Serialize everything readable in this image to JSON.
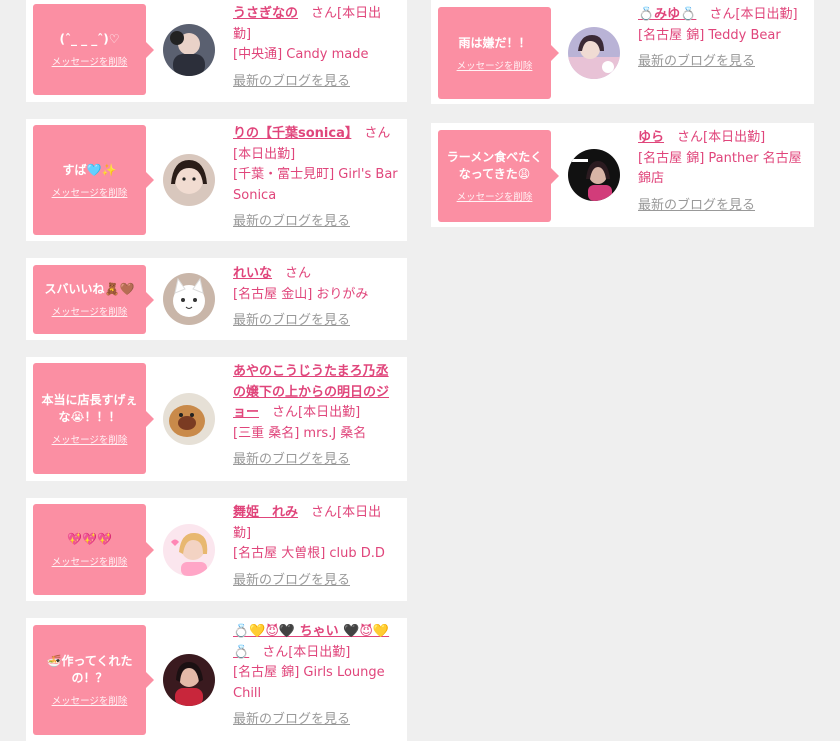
{
  "delete_label": "メッセージを削除",
  "blog_label": "最新のブログを見る",
  "colors": {
    "bubble": "#fb8fa3",
    "accent": "#e0457b",
    "link_gray": "#999999"
  },
  "left": [
    {
      "message": "(ˆ_ _ _ˆ)♡",
      "name": "うさぎなの",
      "status": "さん[本日出勤]",
      "shop": "[中央通] Candy made"
    },
    {
      "message": "すば🩵✨",
      "name": "りの【千葉sonica】",
      "status": "さん[本日出勤]",
      "shop": "[千葉・富士見町] Girl's Bar Sonica"
    },
    {
      "message": "スバいいね🧸🤎",
      "name": "れいな",
      "status": "さん",
      "shop": "[名古屋 金山] おりがみ"
    },
    {
      "message": "本当に店長すげぇな😭！！！",
      "name": "あやのこうじうたまろ乃丞の嬢下の上からの明日のジョー",
      "status": "さん[本日出勤]",
      "shop": "[三重 桑名] mrs.J 桑名"
    },
    {
      "message": "💖💖💖",
      "name": "舞姫　れみ",
      "status": "さん[本日出勤]",
      "shop": "[名古屋 大曽根] club D.D"
    },
    {
      "message": "🍜作ってくれたの！？",
      "name": "💍💛😈🖤 ちゃい 🖤😈💛💍",
      "status": "さん[本日出勤]",
      "shop": "[名古屋 錦] Girls Lounge Chill"
    }
  ],
  "right": [
    {
      "message": "雨は嫌だ！！",
      "name": "💍みゆ💍",
      "status": "さん[本日出勤]",
      "shop": "[名古屋 錦] Teddy Bear"
    },
    {
      "message": "ラーメン食べたくなってきた😩",
      "name": "ゆら",
      "status": "さん[本日出勤]",
      "shop": "[名古屋 錦] Panther 名古屋錦店"
    }
  ]
}
